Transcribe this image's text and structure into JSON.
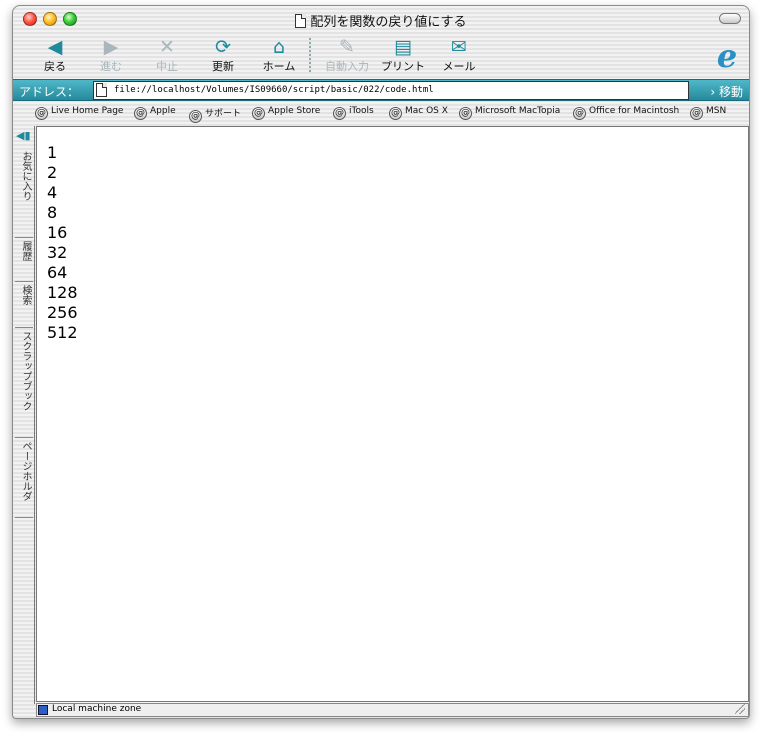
{
  "window": {
    "title": "配列を関数の戻り値にする"
  },
  "toolbar": {
    "back": "戻る",
    "forward": "進む",
    "stop": "中止",
    "refresh": "更新",
    "home": "ホーム",
    "autofill": "自動入力",
    "print": "プリント",
    "mail": "メール"
  },
  "address": {
    "label": "アドレス：",
    "url": "file://localhost/Volumes/IS09660/script/basic/022/code.html",
    "go": "移動"
  },
  "favorites": [
    "Live Home Page",
    "Apple",
    "サポート",
    "Apple Store",
    "iTools",
    "Mac OS X",
    "Microsoft MacTopia",
    "Office for Macintosh",
    "MSN"
  ],
  "sidebar_tabs": [
    "お気に入り",
    "履歴",
    "検索",
    "スクラップブック",
    "ページホルダ"
  ],
  "output_lines": [
    "1",
    "2",
    "4",
    "8",
    "16",
    "32",
    "64",
    "128",
    "256",
    "512"
  ],
  "status": {
    "text": "Local machine zone"
  }
}
